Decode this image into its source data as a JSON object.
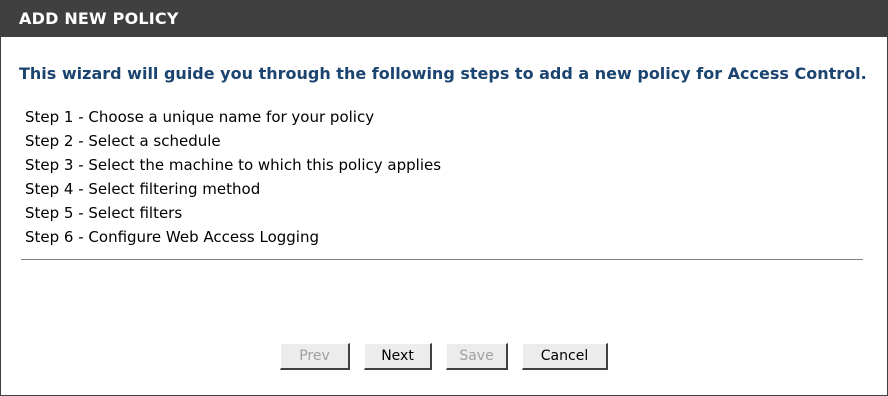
{
  "header": {
    "title": "ADD NEW POLICY"
  },
  "intro": {
    "text": "This wizard will guide you through the following steps to add a new policy for Access Control."
  },
  "steps": [
    "Step 1 - Choose a unique name for your policy",
    "Step 2 - Select a schedule",
    "Step 3 - Select the machine to which this policy applies",
    "Step 4 - Select filtering method",
    "Step 5 - Select filters",
    "Step 6 - Configure Web Access Logging"
  ],
  "buttons": {
    "prev": {
      "label": "Prev",
      "enabled": false
    },
    "next": {
      "label": "Next",
      "enabled": true
    },
    "save": {
      "label": "Save",
      "enabled": false
    },
    "cancel": {
      "label": "Cancel",
      "enabled": true
    }
  },
  "colors": {
    "header_bg": "#404040",
    "header_text": "#ffffff",
    "intro_text": "#1c4470",
    "disabled_text": "#a0a0a0"
  }
}
